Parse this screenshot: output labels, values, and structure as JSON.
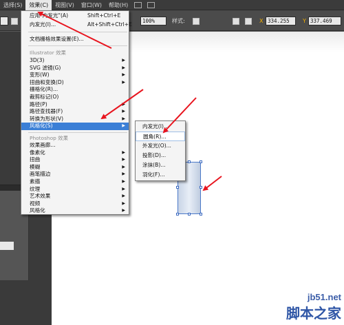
{
  "menubar": {
    "items": [
      {
        "label": "选择(S)"
      },
      {
        "label": "效果(C)"
      },
      {
        "label": "视图(V)"
      },
      {
        "label": "窗口(W)"
      },
      {
        "label": "帮助(H)"
      }
    ]
  },
  "ctrlbar": {
    "opacity": "100%",
    "style_label": "样式:",
    "x_value": "334.255",
    "y_value": "337.469"
  },
  "effect_menu": {
    "apply_last": {
      "label": "应用\"内发光\"(A)",
      "shortcut": "Shift+Ctrl+E"
    },
    "last_effect": {
      "label": "内发光(I)...",
      "shortcut": "Alt+Shift+Ctrl+E"
    },
    "raster_settings": "文档栅格效果设置(E)...",
    "illustrator_header": "Illustrator 效果",
    "illustrator_items": [
      "3D(3)",
      "SVG 滤镜(G)",
      "变形(W)",
      "扭曲和变换(D)",
      "栅格化(R)...",
      "裁剪标记(O)",
      "路径(P)",
      "路径查找器(F)",
      "转换为形状(V)",
      "风格化(S)"
    ],
    "photoshop_header": "Photoshop 效果",
    "photoshop_items": [
      "效果画廊...",
      "像素化",
      "扭曲",
      "模糊",
      "画笔描边",
      "素描",
      "纹理",
      "艺术效果",
      "视频",
      "风格化"
    ]
  },
  "stylize_submenu": {
    "items": [
      "内发光(I)...",
      "圆角(R)...",
      "外发光(O)...",
      "投影(D)...",
      "涂抹(B)...",
      "羽化(F)..."
    ]
  },
  "watermark": {
    "site": "jb51.net",
    "cn": "脚本之家"
  },
  "colors": {
    "highlight": "#3b7fd6",
    "arrow": "#e8141e"
  }
}
